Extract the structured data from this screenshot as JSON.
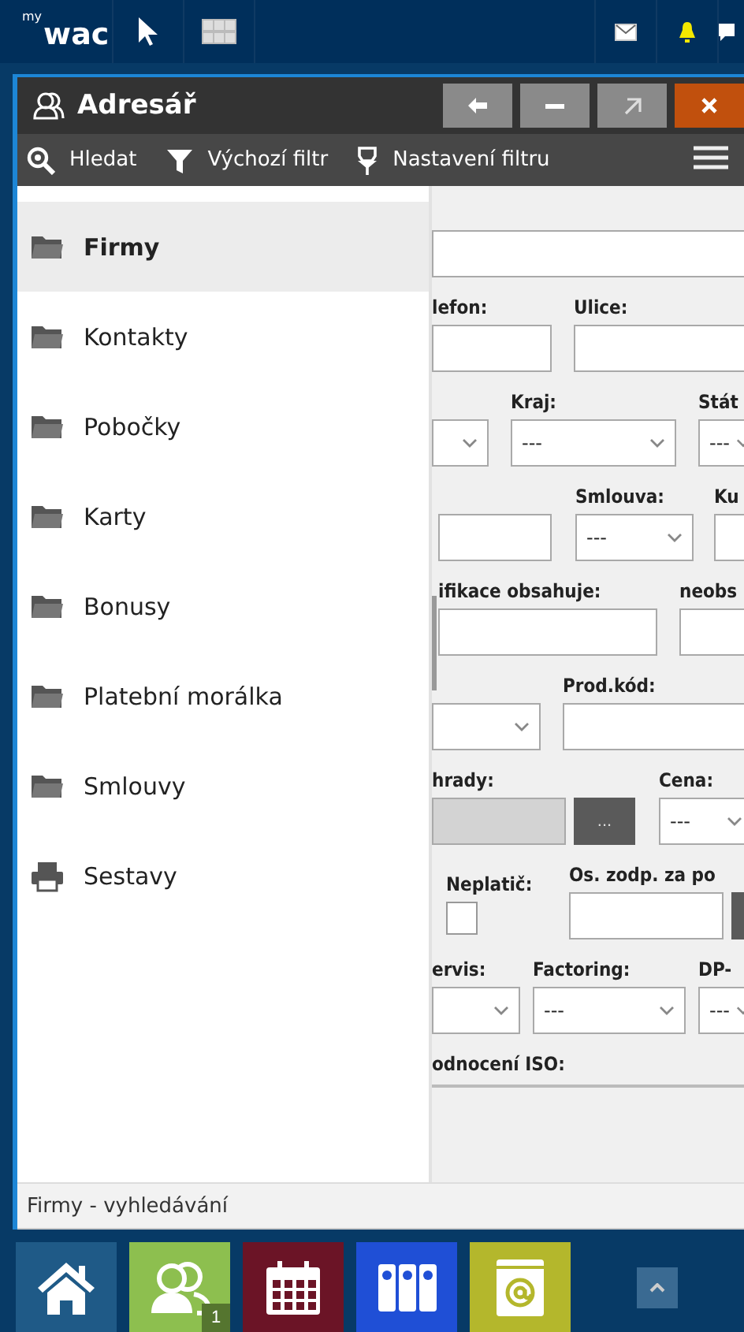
{
  "topbar": {
    "logo_small": "my",
    "logo": "wac"
  },
  "window": {
    "title": "Adresář"
  },
  "toolbar": [
    {
      "label": "Hledat",
      "kind": "search"
    },
    {
      "label": "Výchozí filtr",
      "kind": "filter"
    },
    {
      "label": "Nastavení filtru",
      "kind": "settings"
    }
  ],
  "sidebar": {
    "items": [
      {
        "label": "Firmy",
        "kind": "folder",
        "selected": true
      },
      {
        "label": "Kontakty",
        "kind": "folder",
        "selected": false
      },
      {
        "label": "Pobočky",
        "kind": "folder",
        "selected": false
      },
      {
        "label": "Karty",
        "kind": "folder",
        "selected": false
      },
      {
        "label": "Bonusy",
        "kind": "folder",
        "selected": false
      },
      {
        "label": "Platební morálka",
        "kind": "folder",
        "selected": false
      },
      {
        "label": "Smlouvy",
        "kind": "folder",
        "selected": false
      },
      {
        "label": "Sestavy",
        "kind": "report",
        "selected": false
      }
    ]
  },
  "form": {
    "rows": [
      {
        "columns": [
          {
            "field": {
              "kind": "input"
            }
          }
        ]
      },
      {
        "columns": [
          {
            "label": "lefon:",
            "field": {
              "kind": "input"
            }
          },
          {
            "label": "Ulice:",
            "field": {
              "kind": "input"
            }
          }
        ]
      },
      {
        "columns": [
          {
            "field": {
              "kind": "select"
            }
          },
          {
            "label": "Kraj:",
            "field": {
              "kind": "select",
              "value": "---"
            }
          },
          {
            "label": "Stát",
            "field": {
              "kind": "select",
              "value": "---"
            }
          }
        ]
      },
      {
        "columns": [
          {
            "field": {
              "kind": "input"
            }
          },
          {
            "label": "Smlouva:",
            "field": {
              "kind": "select",
              "value": "---"
            }
          },
          {
            "label": "Ku",
            "field": {
              "kind": "input"
            }
          }
        ]
      },
      {
        "columns": [
          {
            "label": "ifikace obsahuje:",
            "field": {
              "kind": "input"
            }
          },
          {
            "label": "neobs",
            "field": {
              "kind": "input"
            }
          }
        ]
      },
      {
        "columns": [
          {
            "field": {
              "kind": "select"
            }
          },
          {
            "label": "Prod.kód:",
            "field": {
              "kind": "input"
            }
          }
        ]
      },
      {
        "columns": [
          {
            "label": "hrady:",
            "field": {
              "kind": "input",
              "disabled": true
            }
          },
          {
            "field": {
              "kind": "button",
              "label": "..."
            }
          },
          {
            "label": "Cena:",
            "field": {
              "kind": "select",
              "value": "---"
            }
          }
        ]
      },
      {
        "columns": [
          {
            "label": "Neplatič:",
            "field": {
              "kind": "checkbox",
              "checked": false
            }
          },
          {
            "label": "Os. zodp. za po",
            "field": {
              "kind": "input"
            }
          },
          {
            "field": {
              "kind": "button"
            }
          }
        ]
      },
      {
        "columns": [
          {
            "label": "ervis:",
            "field": {
              "kind": "select"
            }
          },
          {
            "label": "Factoring:",
            "field": {
              "kind": "select",
              "value": "---"
            }
          },
          {
            "label": "DP-",
            "field": {
              "kind": "select",
              "value": "---"
            }
          }
        ]
      },
      {
        "columns": [
          {
            "label": "odnocení ISO:",
            "field": {
              "kind": "rule"
            }
          }
        ]
      }
    ]
  },
  "status_bar": "Firmy - vyhledávání",
  "taskbar": [
    {
      "kind": "home",
      "color": "#1f5a87"
    },
    {
      "kind": "contacts",
      "color": "#8dbf4f",
      "badge": "1"
    },
    {
      "kind": "calendar",
      "color": "#6b1426"
    },
    {
      "kind": "binders",
      "color": "#1f4fd6"
    },
    {
      "kind": "mail",
      "color": "#b4b72c"
    }
  ]
}
